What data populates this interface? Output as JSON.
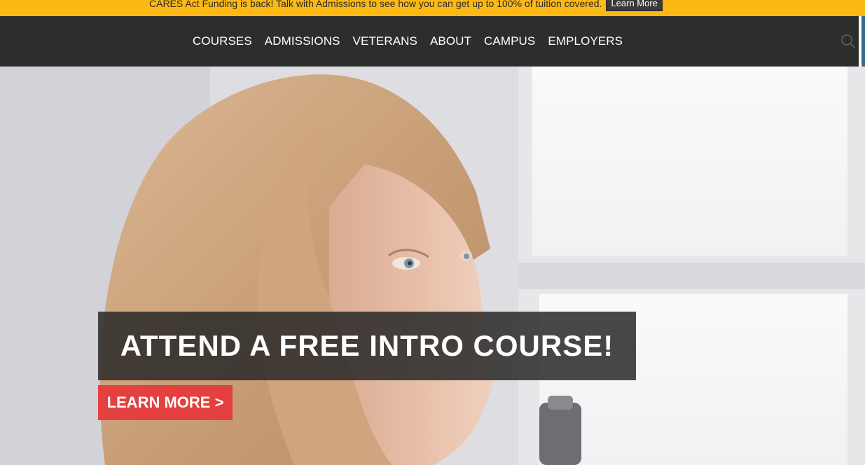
{
  "promo": {
    "text": "CARES Act Funding is back! Talk with Admissions to see how you can get up to 100% of tuition covered.",
    "button_label": "Learn More"
  },
  "nav": {
    "items": [
      {
        "label": "COURSES"
      },
      {
        "label": "ADMISSIONS"
      },
      {
        "label": "VETERANS"
      },
      {
        "label": "ABOUT"
      },
      {
        "label": "CAMPUS"
      },
      {
        "label": "EMPLOYERS"
      }
    ],
    "search_icon": "search-icon"
  },
  "hero": {
    "headline": "ATTEND A FREE INTRO COURSE!",
    "cta_label": "LEARN MORE >"
  },
  "colors": {
    "promo_bar": "#fdb913",
    "navbar": "#2d2d2d",
    "cta": "#e3403f"
  }
}
